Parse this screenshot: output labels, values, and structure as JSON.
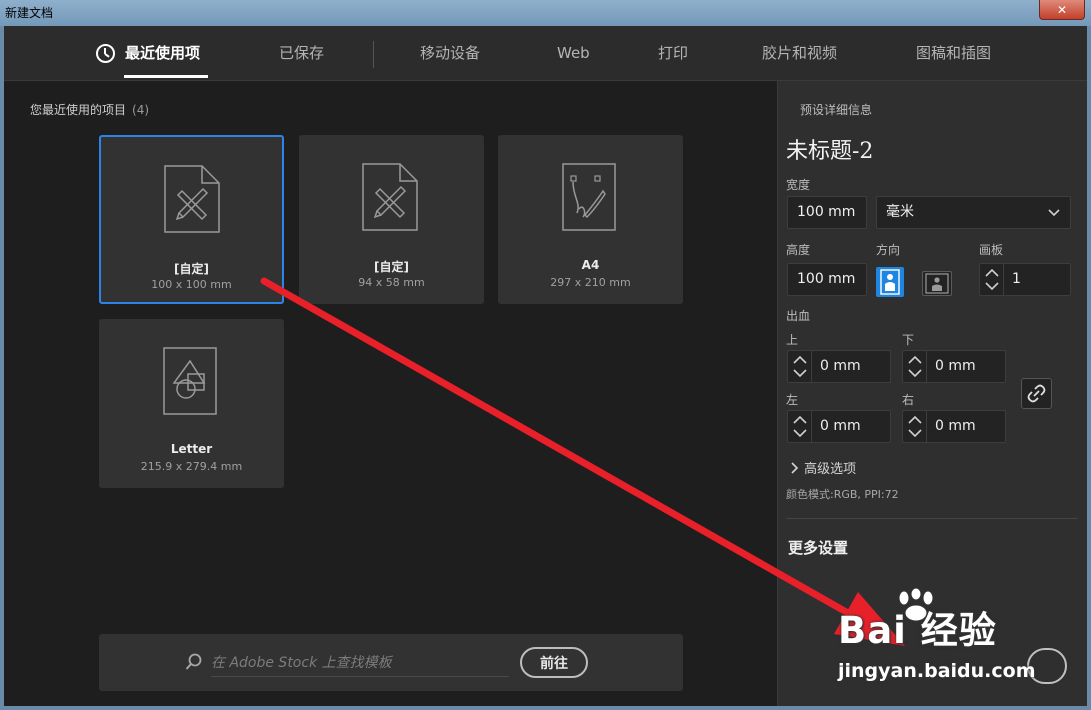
{
  "window": {
    "title": "新建文档",
    "close_glyph": "✕"
  },
  "nav": {
    "tabs": [
      {
        "label": "最近使用项",
        "active": true
      },
      {
        "label": "已保存"
      },
      {
        "label": "移动设备"
      },
      {
        "label": "Web"
      },
      {
        "label": "打印"
      },
      {
        "label": "胶片和视频"
      },
      {
        "label": "图稿和插图"
      }
    ]
  },
  "recent": {
    "heading": "您最近使用的项目",
    "count": "(4)",
    "items": [
      {
        "name": "[自定]",
        "size": "100 x 100 mm",
        "icon": "custom-doc-icon"
      },
      {
        "name": "[自定]",
        "size": "94 x 58 mm",
        "icon": "custom-doc-icon"
      },
      {
        "name": "A4",
        "size": "297 x 210 mm",
        "icon": "artboard-doc-icon"
      },
      {
        "name": "Letter",
        "size": "215.9 x 279.4 mm",
        "icon": "shapes-doc-icon"
      }
    ]
  },
  "search": {
    "placeholder": "在 Adobe Stock 上查找模板",
    "go_label": "前往"
  },
  "preset": {
    "section_label": "预设详细信息",
    "doc_title": "未标题-2",
    "width_label": "宽度",
    "width_value": "100 mm",
    "unit_value": "毫米",
    "height_label": "高度",
    "height_value": "100 mm",
    "orientation_label": "方向",
    "artboards_label": "画板",
    "artboards_value": "1",
    "bleed_label": "出血",
    "top_label": "上",
    "top_value": "0 mm",
    "bottom_label": "下",
    "bottom_value": "0 mm",
    "left_label": "左",
    "left_value": "0 mm",
    "right_label": "右",
    "right_value": "0 mm",
    "advanced_label": "高级选项",
    "color_mode": "颜色模式:RGB, PPI:72",
    "more_settings": "更多设置"
  },
  "watermark": {
    "brand": "Bai 经验",
    "url": "jingyan.baidu.com"
  },
  "colors": {
    "accent": "#2d84e8",
    "arrow": "#e8202a",
    "panel": "#2f2f2f",
    "background": "#1e1e1e"
  }
}
